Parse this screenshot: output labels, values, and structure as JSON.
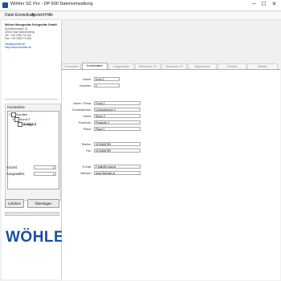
{
  "window": {
    "title": "Wöhler SC Pro - DP 600 Datenverwaltung",
    "minimize_glyph": "─",
    "maximize_glyph": "☐",
    "close_glyph": "✕"
  },
  "menu": [
    "Datei",
    "Einstellung",
    "Ansicht",
    "Hilfe"
  ],
  "company": {
    "name": "Wöhler Messgeräte Kehrgeräte GmbH",
    "lines": [
      "Schützenstraße 41",
      "33181 Bad Wünnenberg",
      "Tel.: +49 2953 73-100",
      "Fax: +49 2953 73-250"
    ],
    "links": [
      "info@woehler.de",
      "http://www.woehler.de"
    ]
  },
  "tree_panel": {
    "header": "Kundenliste",
    "nodes": [
      {
        "label": "Kunden",
        "expander": "⊟"
      },
      {
        "label": "Kund 2",
        "expander": "⊟"
      },
      {
        "label": "Anlage 1",
        "expander": ""
      }
    ]
  },
  "counts": {
    "total_label": "Anzahl:",
    "total_value": "2",
    "selected_label": "Ausgewählt:",
    "selected_value": "1"
  },
  "buttons": {
    "delete": "Löschen",
    "apply": "Übertragen"
  },
  "logo_text": "WÖHLER",
  "tabs": [
    {
      "label": "Grunddaten",
      "active": false
    },
    {
      "label": "Kundendaten",
      "active": true
    },
    {
      "label": "Anlagendaten",
      "active": false
    },
    {
      "label": "Messwerte CO",
      "active": false
    },
    {
      "label": "Messwerte O2",
      "active": false
    },
    {
      "label": "Abgasverlust",
      "active": false
    },
    {
      "label": "Protokoll",
      "active": false
    },
    {
      "label": "Statistik",
      "active": false
    }
  ],
  "form": {
    "fields": [
      {
        "label": "Name:",
        "value": "Kund 2"
      },
      {
        "label": "Nummer:",
        "value": "2"
      },
      {
        "label": "Name / Firma:",
        "value": "Firma 2"
      },
      {
        "label": "Contactperson:",
        "value": "Contactperson 2"
      },
      {
        "label": "Street:",
        "value": "Street 2"
      },
      {
        "label": "Postcode:",
        "value": "Postcode 2"
      },
      {
        "label": "Place:",
        "value": "Place 2"
      },
      {
        "label": "Telefon:",
        "value": "0123456789"
      },
      {
        "label": "Fax:",
        "value": "0123456789"
      },
      {
        "label": "E-mail:",
        "value": "2 Mail@2.mail.at"
      },
      {
        "label": "Website:",
        "value": "www.Website.at"
      }
    ]
  },
  "colors": {
    "accent": "#1a4fa0",
    "background": "#f0f0f0",
    "field_border": "#a8a8a8"
  }
}
